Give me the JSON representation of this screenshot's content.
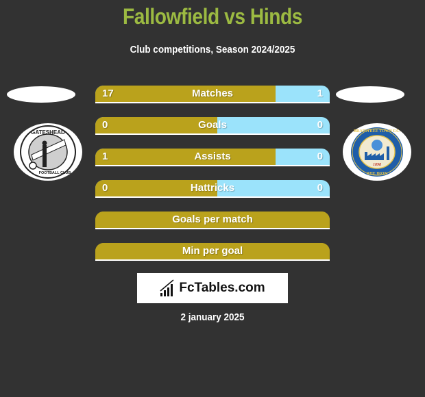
{
  "header": {
    "title": "Fallowfield vs Hinds",
    "subtitle": "Club competitions, Season 2024/2025"
  },
  "teams": {
    "left": {
      "badge_icon": "gateshead-fc-crest",
      "badge_text_top": "GATESHEAD",
      "badge_text_bottom": "FOOTBALL CLUB"
    },
    "right": {
      "badge_icon": "braintree-town-fc-crest",
      "badge_text_top": "BRAINTREE TOWN F.C.",
      "badge_text_bottom": "THE IRON",
      "badge_year": "1898"
    }
  },
  "colors": {
    "background": "#323232",
    "title": "#9cba42",
    "left_bar": "#baa21c",
    "right_bar": "#9be3fb"
  },
  "stats": [
    {
      "label": "Matches",
      "left": "17",
      "right": "1",
      "left_share": 0.77
    },
    {
      "label": "Goals",
      "left": "0",
      "right": "0",
      "left_share": 0.52
    },
    {
      "label": "Assists",
      "left": "1",
      "right": "0",
      "left_share": 0.77
    },
    {
      "label": "Hattricks",
      "left": "0",
      "right": "0",
      "left_share": 0.52
    },
    {
      "label": "Goals per match",
      "left": "",
      "right": "",
      "left_share": 1.0
    },
    {
      "label": "Min per goal",
      "left": "",
      "right": "",
      "left_share": 1.0
    }
  ],
  "footer": {
    "logo_text": "FcTables.com",
    "logo_icon": "bar-chart-icon",
    "date": "2 january 2025"
  }
}
